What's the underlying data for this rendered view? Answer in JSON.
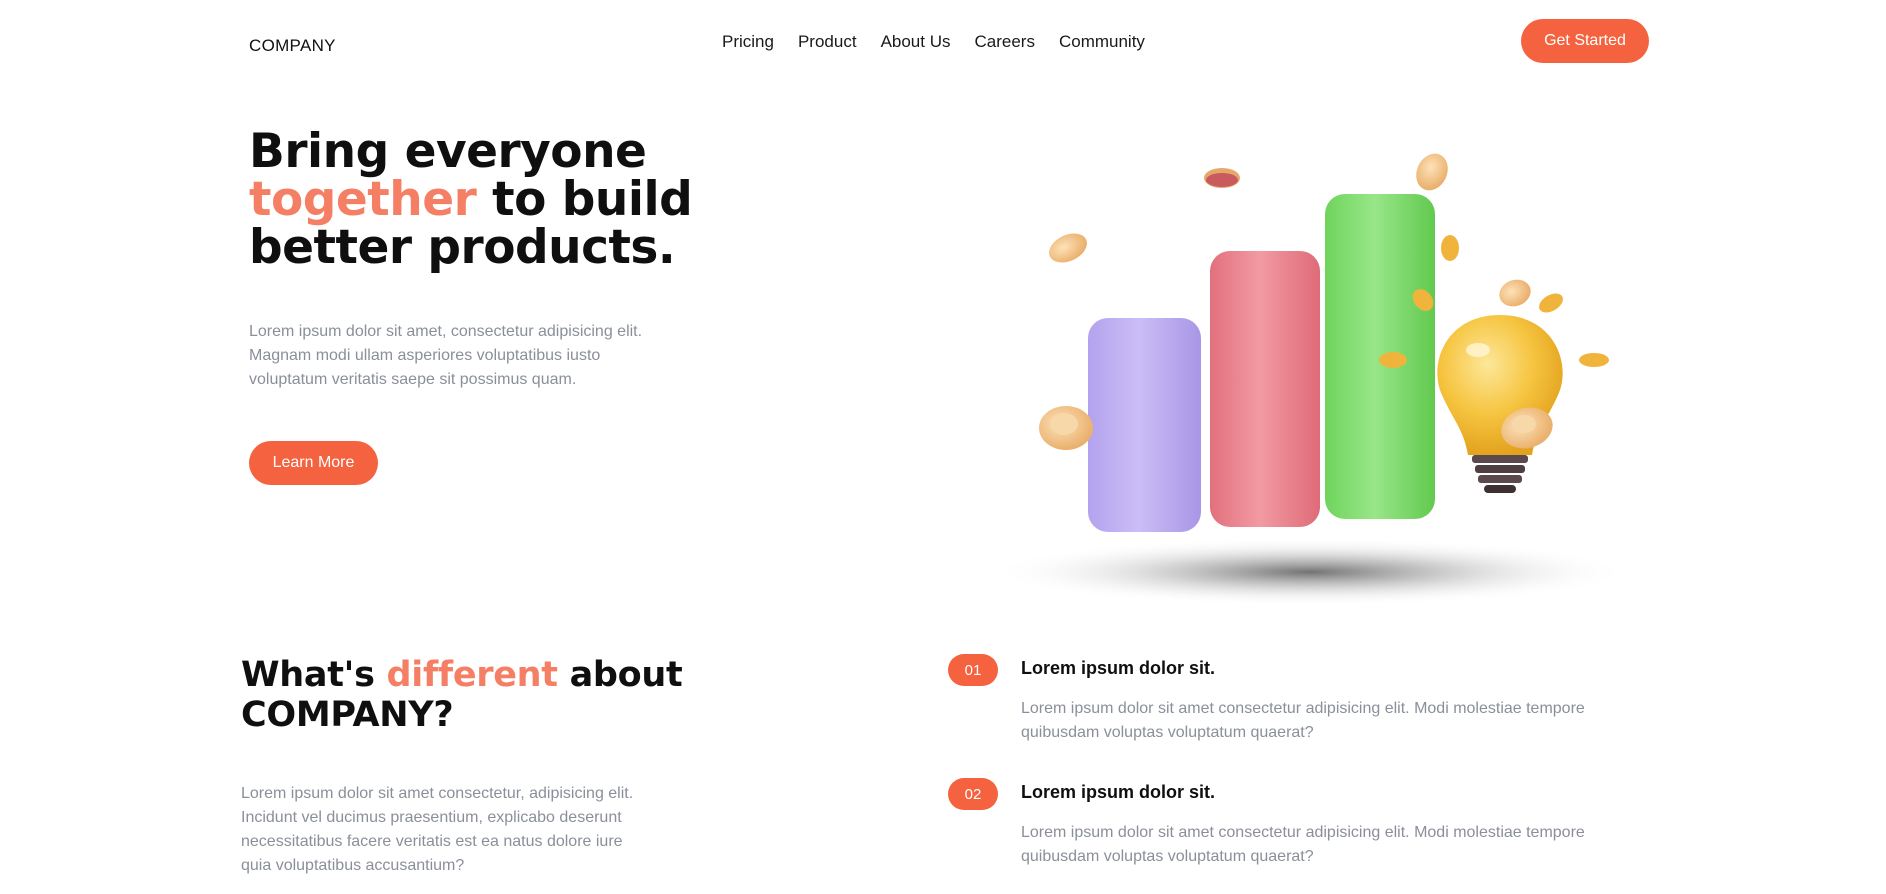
{
  "nav": {
    "logo": "COMPANY",
    "menu": [
      "Pricing",
      "Product",
      "About Us",
      "Careers",
      "Community"
    ],
    "cta": "Get Started"
  },
  "hero": {
    "title_line1": "Bring everyone",
    "title_accent": "together",
    "title_after_accent": " to build",
    "title_line3": "better products.",
    "body": "Lorem ipsum dolor sit amet, consectetur adipisicing elit. Magnam modi ullam asperiores voluptatibus iusto voluptatum veritatis saepe sit possimus quam.",
    "button": "Learn More"
  },
  "different": {
    "title_before": "What's ",
    "title_accent": "different",
    "title_after": " about COMPANY?",
    "body": "Lorem ipsum dolor sit amet consectetur, adipisicing elit. Incidunt vel ducimus praesentium, explicabo deserunt necessitatibus facere veritatis est ea natus dolore iure quia voluptatibus accusantium?"
  },
  "features": [
    {
      "num": "01",
      "title": "Lorem ipsum dolor sit.",
      "body": "Lorem ipsum dolor sit amet consectetur adipisicing elit. Modi molestiae tempore quibusdam voluptas voluptatum quaerat?"
    },
    {
      "num": "02",
      "title": "Lorem ipsum dolor sit.",
      "body": "Lorem ipsum dolor sit amet consectetur adipisicing elit. Modi molestiae tempore quibusdam voluptas voluptatum quaerat?"
    }
  ],
  "colors": {
    "accent": "#f5623f",
    "accent_text": "#f47f65",
    "bar_purple": "#c2b3f2",
    "bar_pink": "#ee8a94",
    "bar_green": "#8fe07c",
    "bulb": "#f5c64a",
    "coin": "#f2c27a"
  },
  "icons": [
    "bar-chart-illustration",
    "lightbulb-icon",
    "coin-icon"
  ]
}
